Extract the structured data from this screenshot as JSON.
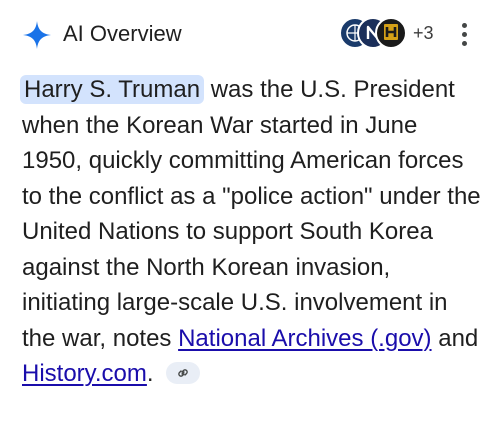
{
  "header": {
    "title": "AI Overview",
    "sources_extra_count": "+3",
    "sources": [
      {
        "icon": "globe-seal-icon"
      },
      {
        "icon": "national-archives-icon"
      },
      {
        "icon": "history-channel-icon"
      }
    ],
    "more_icon": "more-vert-icon"
  },
  "answer": {
    "subject": "Harry S. Truman",
    "text_1": " was the U.S. President when the Korean War started in June 1950, quickly committing American forces to the conflict as a \"police action\" under the United Nations to support South Korea against the North Korean invasion, initiating large-scale U.S. involvement in the war, notes ",
    "link_1": "National Archives (.gov)",
    "text_2": " and ",
    "link_2": "History.com",
    "text_3": ".",
    "chip_icon": "link-icon"
  },
  "colors": {
    "accent": "#1a73e8",
    "link": "#1a0dab",
    "highlight": "#d3e3fd"
  }
}
